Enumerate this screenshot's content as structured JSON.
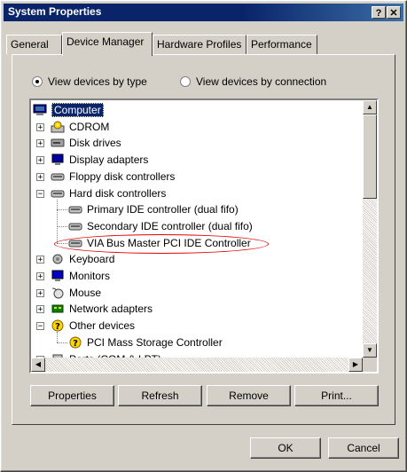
{
  "window": {
    "title": "System Properties",
    "help_btn": "?",
    "close_btn": "✕"
  },
  "tabs": [
    "General",
    "Device Manager",
    "Hardware Profiles",
    "Performance"
  ],
  "radios": [
    {
      "label": "View devices by type",
      "checked": true
    },
    {
      "label": "View devices by connection",
      "checked": false
    }
  ],
  "tree": [
    {
      "label": "Computer",
      "icon": "computer-icon",
      "level": 0,
      "selected": true
    },
    {
      "label": "CDROM",
      "icon": "cdrom-icon",
      "level": 1,
      "expander": "+"
    },
    {
      "label": "Disk drives",
      "icon": "disk-drive-icon",
      "level": 1,
      "expander": "+"
    },
    {
      "label": "Display adapters",
      "icon": "display-icon",
      "level": 1,
      "expander": "+"
    },
    {
      "label": "Floppy disk controllers",
      "icon": "controller-icon",
      "level": 1,
      "expander": "+"
    },
    {
      "label": "Hard disk controllers",
      "icon": "controller-icon",
      "level": 1,
      "expander": "-"
    },
    {
      "label": "Primary IDE controller (dual fifo)",
      "icon": "controller-icon",
      "level": 2
    },
    {
      "label": "Secondary IDE controller (dual fifo)",
      "icon": "controller-icon",
      "level": 2
    },
    {
      "label": "VIA Bus Master PCI IDE Controller",
      "icon": "controller-icon",
      "level": 2
    },
    {
      "label": "Keyboard",
      "icon": "keyboard-icon",
      "level": 1,
      "expander": "+"
    },
    {
      "label": "Monitors",
      "icon": "monitor-icon",
      "level": 1,
      "expander": "+"
    },
    {
      "label": "Mouse",
      "icon": "mouse-icon",
      "level": 1,
      "expander": "+"
    },
    {
      "label": "Network adapters",
      "icon": "network-icon",
      "level": 1,
      "expander": "+"
    },
    {
      "label": "Other devices",
      "icon": "unknown-device-icon",
      "level": 1,
      "expander": "-"
    },
    {
      "label": "PCI Mass Storage Controller",
      "icon": "unknown-device-icon",
      "level": 2
    },
    {
      "label": "Ports (COM & LPT)",
      "icon": "port-icon",
      "level": 1,
      "expander": "+"
    }
  ],
  "actions": {
    "properties": "Properties",
    "refresh": "Refresh",
    "remove": "Remove",
    "print": "Print..."
  },
  "footer": {
    "ok": "OK",
    "cancel": "Cancel"
  },
  "colors": {
    "title_bar": "#0a246a",
    "face": "#d4d0c8",
    "highlight_ellipse": "#e00000"
  }
}
